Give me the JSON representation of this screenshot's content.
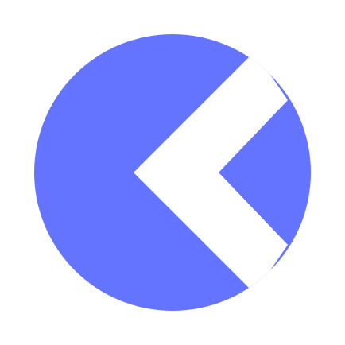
{
  "logo": {
    "icon": "chevron-left-circle-logo",
    "colors": {
      "background": "#ffffff",
      "accent": "#6574FF",
      "cutout": "#ffffff"
    }
  }
}
